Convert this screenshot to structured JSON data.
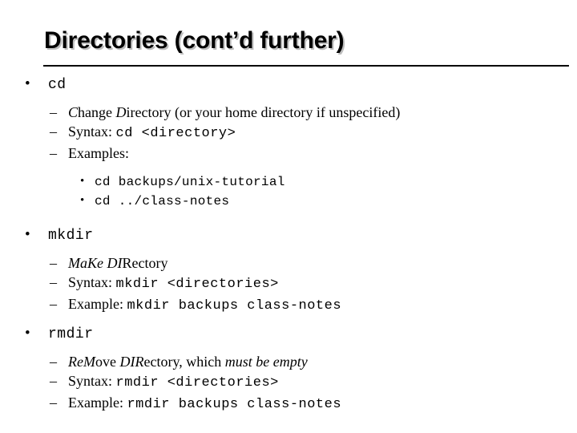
{
  "slide": {
    "title": "Directories (cont’d further)",
    "bullet_glyph": "•",
    "dash_glyph": "–",
    "sections": [
      {
        "command": "cd",
        "items": [
          {
            "parts": [
              {
                "text": "C",
                "style": "italic-serif"
              },
              {
                "text": "hange ",
                "style": "serif"
              },
              {
                "text": "D",
                "style": "italic-serif"
              },
              {
                "text": "irectory (or your home directory if unspecified)",
                "style": "serif"
              }
            ],
            "plain": "Change Directory (or your home directory if unspecified)"
          },
          {
            "label": "Syntax:",
            "code": "cd <directory>",
            "plain": "Syntax: cd <directory>"
          },
          {
            "label": "Examples:",
            "plain": "Examples:"
          }
        ],
        "examples": [
          "cd backups/unix-tutorial",
          "cd ../class-notes"
        ]
      },
      {
        "command": "mkdir",
        "items": [
          {
            "parts": [
              {
                "text": "Ma",
                "style": "italic-serif"
              },
              {
                "text": "Ke ",
                "style": "italic-serif"
              },
              {
                "text": "DI",
                "style": "italic-serif"
              },
              {
                "text": "Rectory",
                "style": "serif"
              }
            ],
            "plain": "MaKe DIRectory"
          },
          {
            "label": "Syntax:",
            "code": "mkdir <directories>",
            "plain": "Syntax: mkdir <directories>"
          },
          {
            "label": "Example:",
            "code": "mkdir backups class-notes",
            "plain": "Example: mkdir backups class-notes"
          }
        ],
        "examples": []
      },
      {
        "command": "rmdir",
        "items": [
          {
            "parts": [
              {
                "text": "ReM",
                "style": "italic-serif"
              },
              {
                "text": "ove ",
                "style": "serif"
              },
              {
                "text": "DIR",
                "style": "italic-serif"
              },
              {
                "text": "ectory, which ",
                "style": "serif"
              },
              {
                "text": "must be empty",
                "style": "italic-serif"
              }
            ],
            "plain": "ReMove DIRectory, which must be empty"
          },
          {
            "label": "Syntax:",
            "code": "rmdir <directories>",
            "plain": "Syntax: rmdir <directories>"
          },
          {
            "label": "Example:",
            "code": "rmdir backups class-notes",
            "plain": "Example: rmdir backups class-notes"
          }
        ],
        "examples": []
      }
    ]
  },
  "colors": {
    "background": "#ffffff",
    "text": "#000000",
    "title_shadow": "#bdbdbd",
    "rule": "#000000"
  }
}
